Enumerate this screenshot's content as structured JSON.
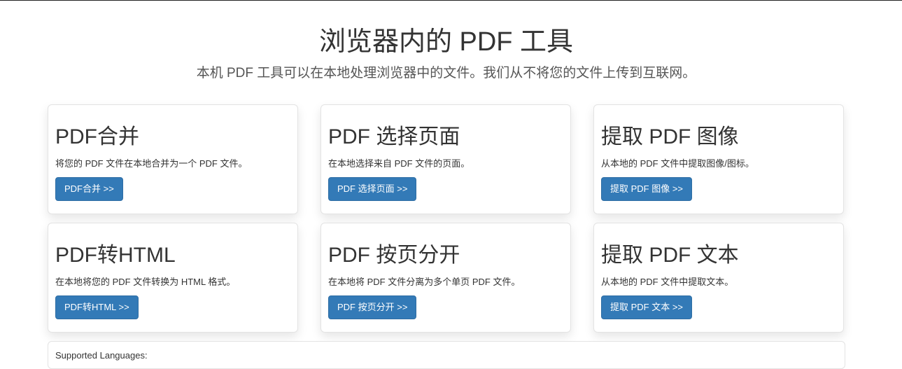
{
  "header": {
    "title": "浏览器内的 PDF 工具",
    "subtitle": "本机 PDF 工具可以在本地处理浏览器中的文件。我们从不将您的文件上传到互联网。"
  },
  "tools": [
    {
      "title": "PDF合并",
      "description": "将您的 PDF 文件在本地合并为一个 PDF 文件。",
      "button_label": "PDF合并 >>"
    },
    {
      "title": "PDF 选择页面",
      "description": "在本地选择来自 PDF 文件的页面。",
      "button_label": "PDF 选择页面 >>"
    },
    {
      "title": "提取 PDF 图像",
      "description": "从本地的 PDF 文件中提取图像/图标。",
      "button_label": "提取 PDF 图像 >>"
    },
    {
      "title": "PDF转HTML",
      "description": "在本地将您的 PDF 文件转换为 HTML 格式。",
      "button_label": "PDF转HTML >>"
    },
    {
      "title": "PDF 按页分开",
      "description": "在本地将 PDF 文件分离为多个单页 PDF 文件。",
      "button_label": "PDF 按页分开 >>"
    },
    {
      "title": "提取 PDF 文本",
      "description": "从本地的 PDF 文件中提取文本。",
      "button_label": "提取 PDF 文本 >>"
    }
  ],
  "languages": {
    "label": "Supported Languages:"
  },
  "colors": {
    "button_bg": "#337ab7",
    "button_text": "#ffffff",
    "title_text": "#333333"
  }
}
